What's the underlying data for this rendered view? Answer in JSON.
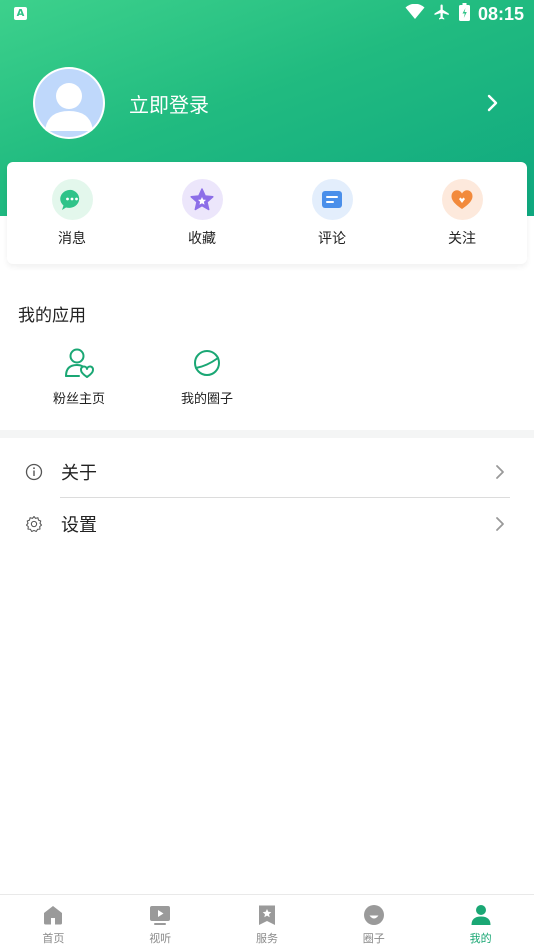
{
  "status_bar": {
    "time": "08:15",
    "left_badge": "A"
  },
  "profile": {
    "login_label": "立即登录"
  },
  "quick_actions": [
    {
      "label": "消息",
      "icon": "chat-icon",
      "color": "#2fc389"
    },
    {
      "label": "收藏",
      "icon": "star-icon",
      "color": "#8c6ee8"
    },
    {
      "label": "评论",
      "icon": "comment-icon",
      "color": "#4a8fea"
    },
    {
      "label": "关注",
      "icon": "heart-icon",
      "color": "#f28a3c"
    }
  ],
  "apps": {
    "title": "我的应用",
    "items": [
      {
        "label": "粉丝主页",
        "icon": "fan-user-icon"
      },
      {
        "label": "我的圈子",
        "icon": "planet-icon"
      }
    ]
  },
  "menu": [
    {
      "label": "关于",
      "icon": "info-icon"
    },
    {
      "label": "设置",
      "icon": "gear-icon"
    }
  ],
  "tabbar": {
    "active_index": 4,
    "accent": "#1aa774",
    "items": [
      {
        "label": "首页",
        "icon": "home-icon"
      },
      {
        "label": "视听",
        "icon": "play-icon"
      },
      {
        "label": "服务",
        "icon": "bookmark-star-icon"
      },
      {
        "label": "圈子",
        "icon": "circle-icon"
      },
      {
        "label": "我的",
        "icon": "user-icon"
      }
    ]
  }
}
